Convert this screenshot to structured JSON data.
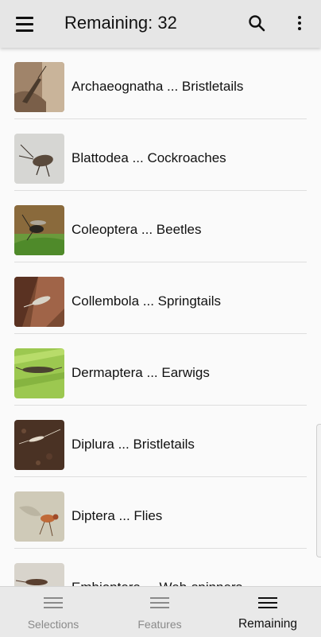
{
  "app_bar": {
    "title": "Remaining: 32",
    "menu_icon": "hamburger-menu-icon",
    "search_icon": "search-icon",
    "more_icon": "more-vert-icon"
  },
  "orders": [
    {
      "label": "Archaeognatha ... Bristletails"
    },
    {
      "label": "Blattodea ... Cockroaches"
    },
    {
      "label": "Coleoptera ... Beetles"
    },
    {
      "label": "Collembola ... Springtails"
    },
    {
      "label": "Dermaptera ... Earwigs"
    },
    {
      "label": "Diplura ... Bristletails"
    },
    {
      "label": "Diptera ... Flies"
    },
    {
      "label": "Embioptera ... Web-spinners"
    }
  ],
  "bottom_nav": {
    "items": [
      {
        "label": "Selections",
        "icon": "list-icon",
        "active": false
      },
      {
        "label": "Features",
        "icon": "list-icon",
        "active": false
      },
      {
        "label": "Remaining",
        "icon": "list-icon",
        "active": true
      }
    ]
  },
  "colors": {
    "app_bar_bg": "#e6e6e6",
    "list_bg": "#fafafa",
    "nav_bg": "#e9e9e9",
    "nav_active": "#111111",
    "nav_inactive": "#8a8a8a"
  }
}
